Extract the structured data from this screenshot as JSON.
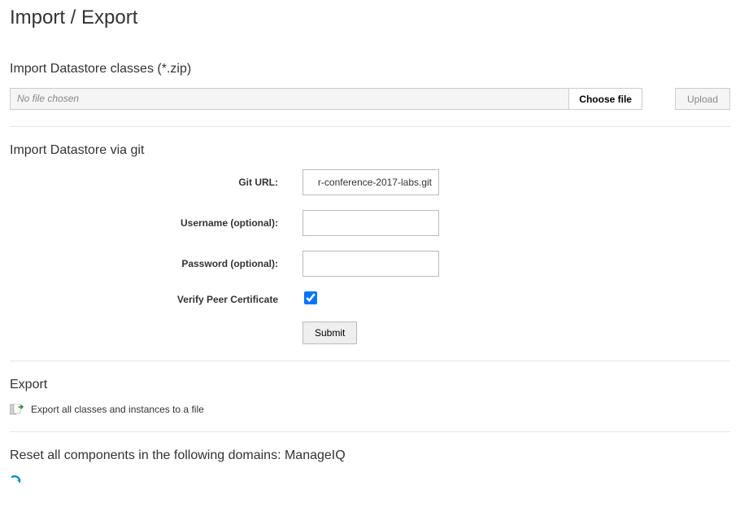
{
  "page_title": "Import / Export",
  "import_zip": {
    "heading": "Import Datastore classes (*.zip)",
    "file_placeholder": "No file chosen",
    "choose_file_label": "Choose file",
    "upload_label": "Upload"
  },
  "import_git": {
    "heading": "Import Datastore via git",
    "git_url_label": "Git URL:",
    "git_url_value": "r-conference-2017-labs.git",
    "username_label": "Username (optional):",
    "username_value": "",
    "password_label": "Password (optional):",
    "password_value": "",
    "verify_label": "Verify Peer Certificate",
    "verify_checked": true,
    "submit_label": "Submit"
  },
  "export": {
    "heading": "Export",
    "link_text": "Export all classes and instances to a file"
  },
  "reset": {
    "heading": "Reset all components in the following domains: ManageIQ"
  }
}
